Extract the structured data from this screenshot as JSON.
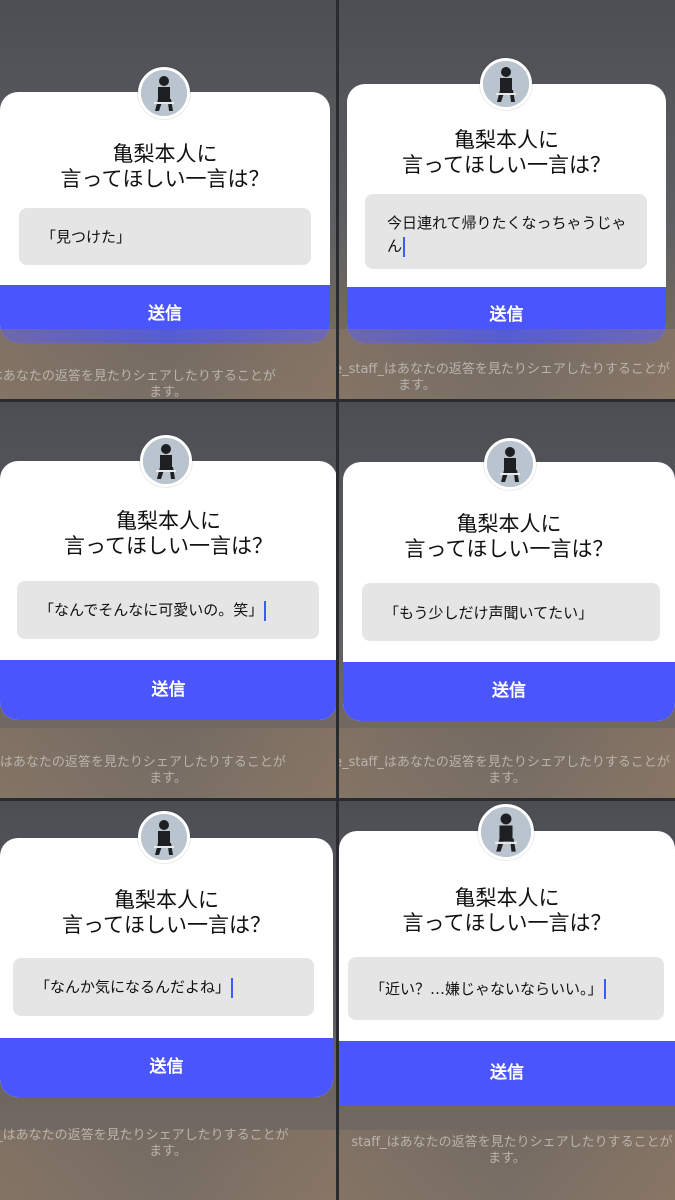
{
  "panels": [
    {
      "question": [
        "亀梨本人に",
        "言ってほしい一言は？"
      ],
      "answer": "「見つけた」",
      "send": "送信",
      "note": [
        "e_staff_はあなたの返答を見たりシェアしたりすることが",
        "ます。"
      ]
    },
    {
      "question": [
        "亀梨本人に",
        "言ってほしい一言は？"
      ],
      "answer": "今日連れて帰りたくなっちゃうじゃん",
      "send": "送信",
      "note": [
        "e_staff_はあなたの返答を見たりシェアしたりすることが",
        "ます。"
      ]
    },
    {
      "question": [
        "亀梨本人に",
        "言ってほしい一言は？"
      ],
      "answer": "「なんでそんなに可愛いの。笑」",
      "send": "送信",
      "note": [
        "e_staff_はあなたの返答を見たりシェアしたりすることが",
        "ます。"
      ]
    },
    {
      "question": [
        "亀梨本人に",
        "言ってほしい一言は？"
      ],
      "answer": "「もう少しだけ声聞いてたい」",
      "send": "送信",
      "note": [
        "e_staff_はあなたの返答を見たりシェアしたりすることが",
        "ます。"
      ]
    },
    {
      "question": [
        "亀梨本人に",
        "言ってほしい一言は？"
      ],
      "answer": "「なんか気になるんだよね」",
      "send": "送信",
      "note": [
        "staff_はあなたの返答を見たりシェアしたりすることが",
        "ます。"
      ]
    },
    {
      "question": [
        "亀梨本人に",
        "言ってほしい一言は？"
      ],
      "answer": "「近い？…嫌じゃないならいい。」",
      "send": "送信",
      "note": [
        "staff_はあなたの返答を見たりシェアしたりすることが",
        "ます。"
      ]
    }
  ],
  "icons": {
    "avatar": "person-seated-avatar-icon"
  },
  "colors": {
    "send_button": "#4a56fb",
    "caret": "#3d5afe",
    "answer_bg": "#e5e5e6"
  }
}
